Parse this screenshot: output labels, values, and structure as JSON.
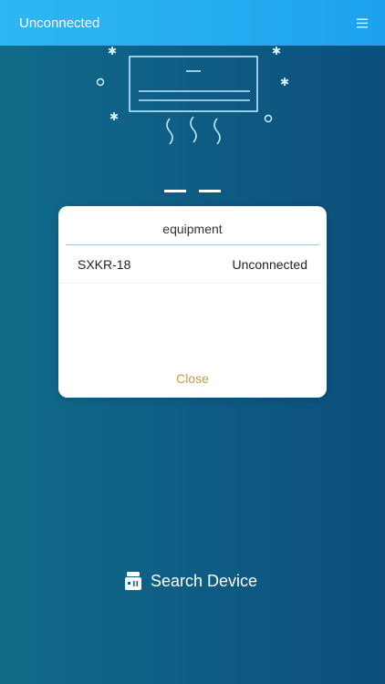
{
  "header": {
    "title": "Unconnected",
    "menu_icon": "hamburger-menu-icon"
  },
  "display": {
    "temperature": "— —",
    "illustration_icon": "air-conditioner-icon"
  },
  "dialog": {
    "title": "equipment",
    "devices": [
      {
        "name": "SXKR-18",
        "status": "Unconnected"
      }
    ],
    "close_label": "Close"
  },
  "footer": {
    "search_label": "Search Device",
    "search_icon": "search-device-icon"
  },
  "colors": {
    "header_start": "#2fb7f2",
    "header_end": "#1ea2ee",
    "background_start": "#116c89",
    "background_end": "#0c4f7c",
    "close_text": "#c79a52",
    "divider": "#9fc3d7"
  }
}
